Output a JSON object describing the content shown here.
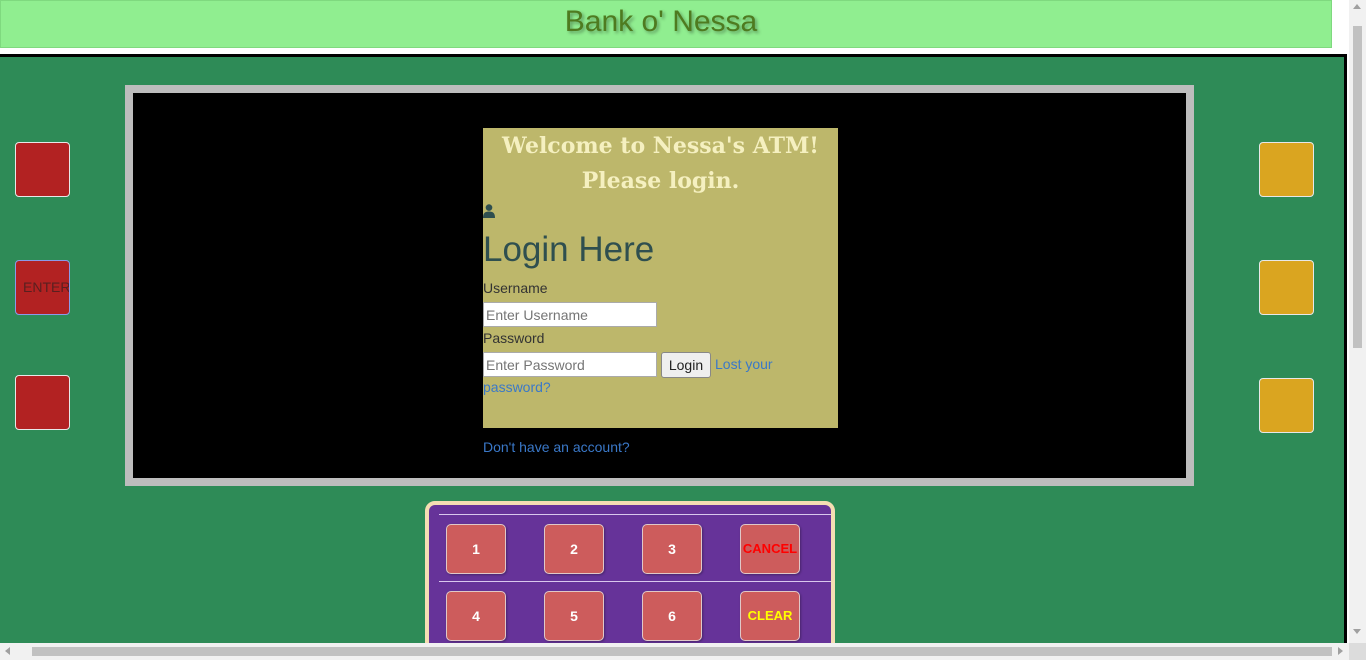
{
  "header": {
    "title": "Bank o' Nessa"
  },
  "side_buttons": {
    "left": [
      {
        "label": "",
        "color": "#b22222"
      },
      {
        "label": "ENTER",
        "color": "#b22222"
      },
      {
        "label": "",
        "color": "#b22222"
      }
    ],
    "right": [
      {
        "label": "",
        "color": "#daa520"
      },
      {
        "label": "",
        "color": "#daa520"
      },
      {
        "label": "",
        "color": "#daa520"
      }
    ]
  },
  "login": {
    "welcome_line1": "Welcome to Nessa's ATM!",
    "welcome_line2": "Please login.",
    "user_icon": "user-icon",
    "title": "Login Here",
    "username_label": "Username",
    "username_placeholder": "Enter Username",
    "password_label": "Password",
    "password_placeholder": "Enter Password",
    "login_button": "Login",
    "lost_password_line1": "Lost your",
    "lost_password_line2": "password?",
    "signup_link": "Don't have an account?"
  },
  "keypad": {
    "rows": [
      [
        "1",
        "2",
        "3",
        "CANCEL"
      ],
      [
        "4",
        "5",
        "6",
        "CLEAR"
      ]
    ]
  },
  "colors": {
    "header_bg": "#90ee90",
    "atm_bg": "#2e8b57",
    "panel_bg": "#bdb76b",
    "keypad_bg": "#663399",
    "key_bg": "#cd5c5c",
    "cancel_text": "#ff0000",
    "clear_text": "#ffff00"
  }
}
